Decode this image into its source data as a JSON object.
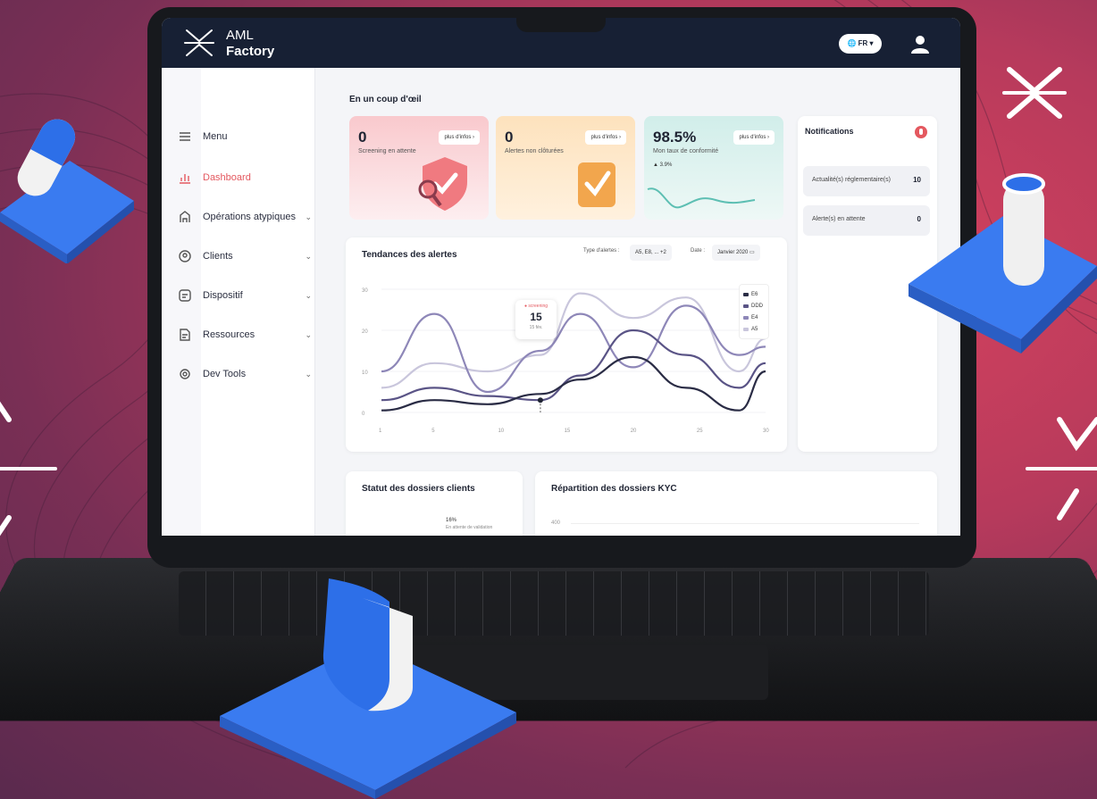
{
  "app": {
    "brand_line1": "AML",
    "brand_line2": "Factory",
    "language": "FR"
  },
  "sidebar": {
    "items": [
      {
        "label": "Menu",
        "icon": "menu-icon",
        "active": false,
        "has_chevron": false
      },
      {
        "label": "Dashboard",
        "icon": "dashboard-icon",
        "active": true,
        "has_chevron": false
      },
      {
        "label": "Opérations atypiques",
        "icon": "operations-icon",
        "active": false,
        "has_chevron": true
      },
      {
        "label": "Clients",
        "icon": "clients-icon",
        "active": false,
        "has_chevron": true
      },
      {
        "label": "Dispositif",
        "icon": "dispositif-icon",
        "active": false,
        "has_chevron": true
      },
      {
        "label": "Ressources",
        "icon": "resources-icon",
        "active": false,
        "has_chevron": true
      },
      {
        "label": "Dev Tools",
        "icon": "dev-tools-icon",
        "active": false,
        "has_chevron": true
      }
    ]
  },
  "overview": {
    "title": "En un coup d'œil",
    "kpis": [
      {
        "value": "0",
        "label": "Screening en attente",
        "more": "plus d'infos",
        "color": "#f8d6d9"
      },
      {
        "value": "0",
        "label": "Alertes non clôturées",
        "more": "plus d'infos",
        "color": "#fde6c7"
      },
      {
        "value": "98.5%",
        "label": "Mon taux de conformité",
        "more": "plus d'infos",
        "delta": "▲ 3.9%",
        "color": "#d7efee"
      }
    ]
  },
  "notifications": {
    "title": "Notifications",
    "rows": [
      {
        "label": "Actualité(s) réglementaire(s)",
        "count": "10"
      },
      {
        "label": "Alerte(s) en attente",
        "count": "0"
      }
    ]
  },
  "trends": {
    "title": "Tendances des alertes",
    "filter_label": "Type d'alertes :",
    "filter_value": "A5, E8, ... +2",
    "date_label": "Date :",
    "date_value": "Janvier 2020",
    "tooltip": {
      "tag": "● screening",
      "value": "15",
      "sub": "15 fév."
    }
  },
  "bottom": {
    "client_status_title": "Statut des dossiers clients",
    "client_status_pct": "16%",
    "client_status_sub": "En attente de validation",
    "kyc_title": "Répartition des dossiers KYC",
    "kyc_tick": "400"
  },
  "chart_data": {
    "type": "line",
    "title": "Tendances des alertes",
    "x": [
      1,
      5,
      10,
      15,
      20,
      25,
      30
    ],
    "x_ticks": [
      "1",
      "5",
      "10",
      "15",
      "20",
      "25",
      "30"
    ],
    "y_ticks": [
      "0",
      "10",
      "20",
      "30"
    ],
    "ylim": [
      0,
      30
    ],
    "legend_position": "top-right",
    "series": [
      {
        "name": "E6",
        "color": "#2a2c45",
        "values": [
          0.5,
          3,
          2,
          4.5,
          8,
          13.5,
          6,
          0.5,
          10
        ]
      },
      {
        "name": "DDD",
        "color": "#5a5486",
        "values": [
          3,
          6,
          4,
          3,
          9,
          20,
          14,
          6,
          12
        ]
      },
      {
        "name": "E4",
        "color": "#8e87b8",
        "values": [
          10,
          24,
          5,
          15,
          24,
          11,
          26,
          14,
          16
        ]
      },
      {
        "name": "A5",
        "color": "#c9c6dc",
        "values": [
          6,
          12,
          10,
          14,
          29,
          23,
          28,
          10,
          18
        ]
      }
    ],
    "x_positions": [
      1,
      5,
      9,
      13,
      16,
      20,
      24,
      28,
      30
    ]
  }
}
